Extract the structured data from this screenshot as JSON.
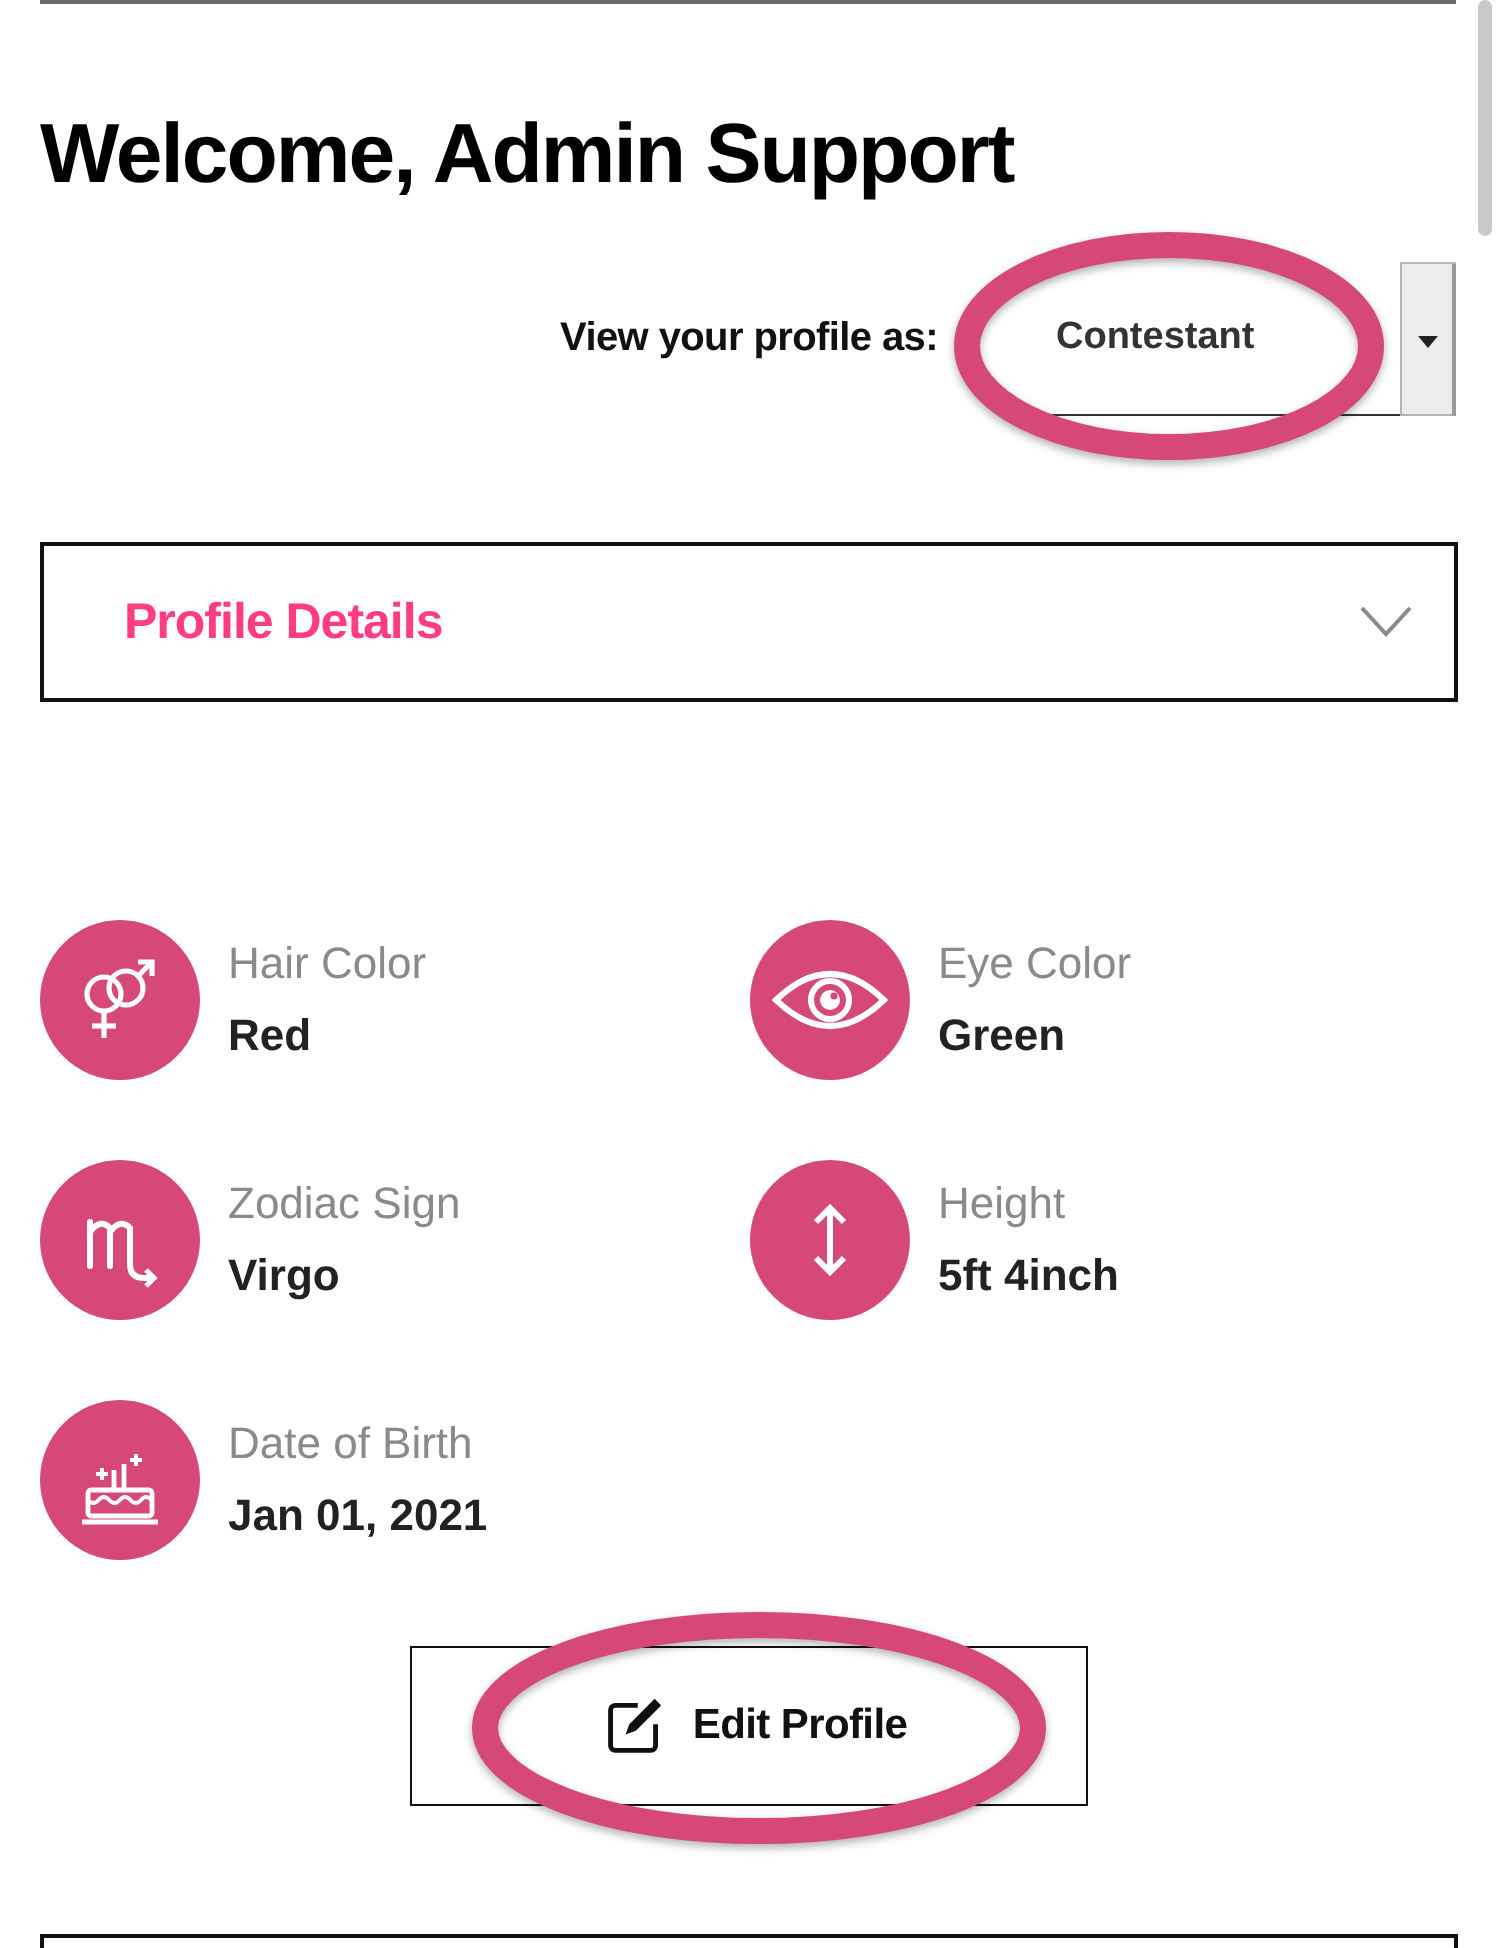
{
  "header": {
    "title": "Welcome, Admin Support"
  },
  "view_as": {
    "label": "View your profile as:",
    "value": "Contestant",
    "highlighted": true
  },
  "accordion": {
    "title": "Profile Details"
  },
  "details": [
    {
      "kind": "gender",
      "label": "Hair Color",
      "value": "Red"
    },
    {
      "kind": "eye",
      "label": "Eye Color",
      "value": "Green"
    },
    {
      "kind": "zodiac",
      "label": "Zodiac Sign",
      "value": "Virgo"
    },
    {
      "kind": "height",
      "label": "Height",
      "value": "5ft 4inch"
    },
    {
      "kind": "cake",
      "label": "Date of Birth",
      "value": "Jan 01, 2021"
    }
  ],
  "edit_button": {
    "label": "Edit Profile",
    "highlighted": true
  }
}
